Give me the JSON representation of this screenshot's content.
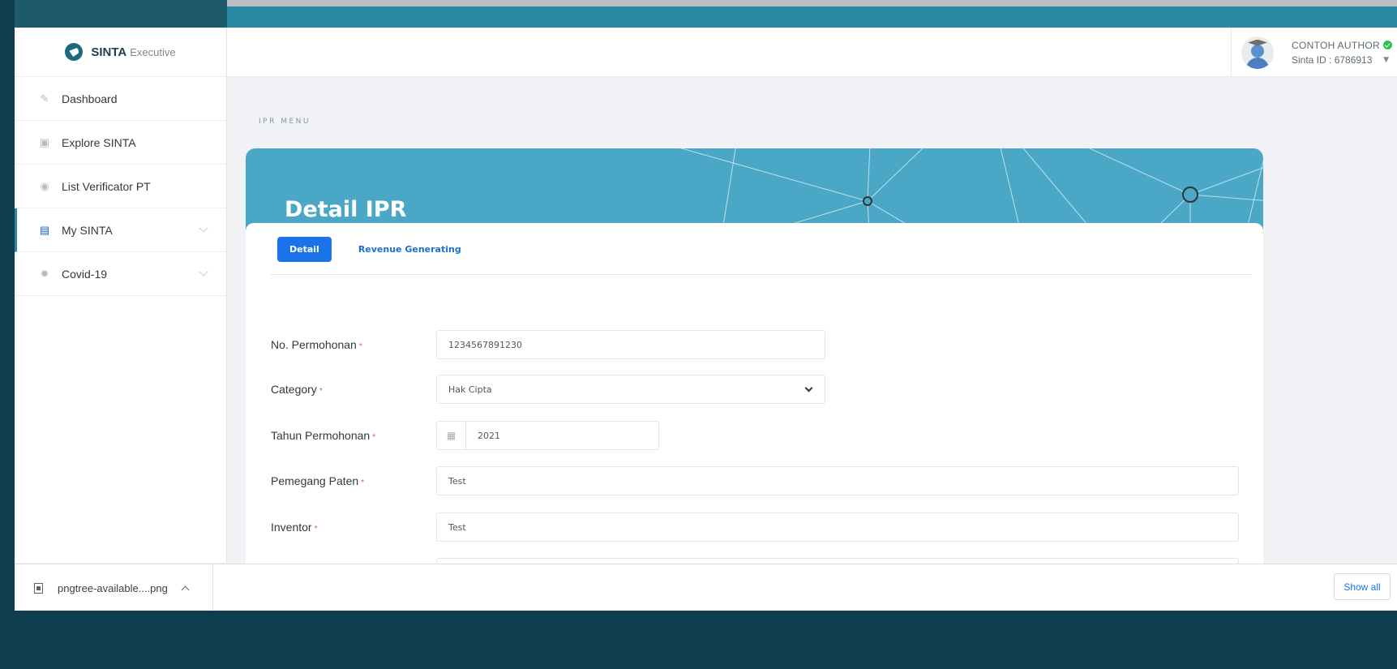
{
  "brand": {
    "name": "SINTA",
    "sub": "Executive"
  },
  "sidebar": {
    "items": [
      {
        "label": "Dashboard",
        "icon": "pencil-icon"
      },
      {
        "label": "Explore SINTA",
        "icon": "document-icon"
      },
      {
        "label": "List Verificator PT",
        "icon": "user-circle-icon"
      },
      {
        "label": "My SINTA",
        "icon": "id-card-icon"
      },
      {
        "label": "Covid-19",
        "icon": "virus-icon"
      }
    ]
  },
  "user": {
    "name": "CONTOH AUTHOR",
    "sinta_id": "Sinta ID : 6786913"
  },
  "page": {
    "section_label": "IPR MENU",
    "title": "Detail IPR"
  },
  "tabs": [
    {
      "label": "Detail"
    },
    {
      "label": "Revenue Generating"
    }
  ],
  "form": {
    "no_permohonan": {
      "label": "No. Permohonan",
      "value": "1234567891230"
    },
    "category": {
      "label": "Category",
      "value": "Hak Cipta"
    },
    "tahun": {
      "label": "Tahun Permohonan",
      "value": "2021"
    },
    "pemegang": {
      "label": "Pemegang Paten",
      "value": "Test"
    },
    "inventor": {
      "label": "Inventor",
      "value": "Test"
    },
    "required_mark": "*"
  },
  "download": {
    "filename": "pngtree-available....png",
    "show_all": "Show all"
  },
  "colors": {
    "accent": "#4aa8c6",
    "primary": "#1a73e8",
    "frame": "#0f3d4d"
  }
}
